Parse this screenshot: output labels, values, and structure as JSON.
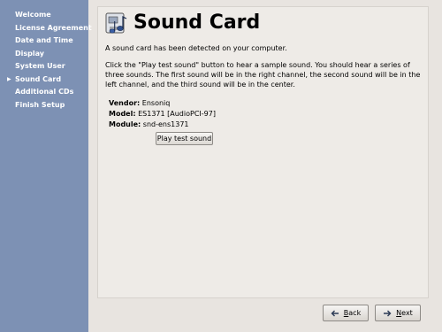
{
  "sidebar": {
    "items": [
      {
        "label": "Welcome",
        "current": false
      },
      {
        "label": "License Agreement",
        "current": false
      },
      {
        "label": "Date and Time",
        "current": false
      },
      {
        "label": "Display",
        "current": false
      },
      {
        "label": "System User",
        "current": false
      },
      {
        "label": "Sound Card",
        "current": true
      },
      {
        "label": "Additional CDs",
        "current": false
      },
      {
        "label": "Finish Setup",
        "current": false
      }
    ],
    "current_marker": "▶"
  },
  "header": {
    "title": "Sound Card",
    "icon": "sound-card-icon"
  },
  "content": {
    "intro": "A sound card has been detected on your computer.",
    "instructions": "Click the \"Play test sound\" button to hear a sample sound.  You should hear a series of three sounds.  The first sound will be in the right channel, the second sound will be in the left channel, and the third sound will be in the center.",
    "vendor_label": "Vendor:",
    "vendor_value": "Ensoniq",
    "model_label": "Model:",
    "model_value": "ES1371 [AudioPCI-97]",
    "module_label": "Module:",
    "module_value": "snd-ens1371",
    "test_button": "Play test sound"
  },
  "footer": {
    "back_label": "Back",
    "back_mnemonic": "B",
    "back_rest": "ack",
    "next_label": "Next",
    "next_mnemonic": "N",
    "next_rest": "ext"
  },
  "colors": {
    "sidebar_bg": "#7d91b4",
    "window_bg": "#e8e4e0",
    "panel_bg": "#eeebe7"
  }
}
